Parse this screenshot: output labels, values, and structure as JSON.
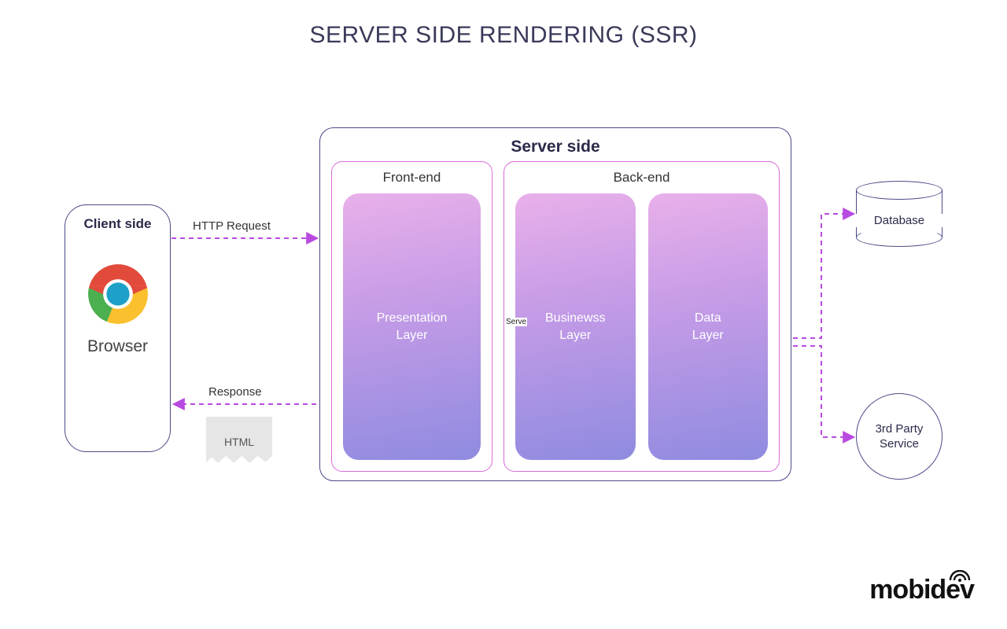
{
  "title": "SERVER SIDE RENDERING (SSR)",
  "client": {
    "box_label": "Client side",
    "browser_label": "Browser"
  },
  "server": {
    "box_label": "Server side",
    "frontend": {
      "label": "Front-end",
      "layer": "Presentation\nLayer"
    },
    "backend": {
      "label": "Back-end",
      "business_layer": "Businewss\nLayer",
      "data_layer": "Data\nLayer"
    }
  },
  "external": {
    "database": "Database",
    "third_party": "3rd Party\nService"
  },
  "arrows": {
    "request": "HTTP Request",
    "response": "Response",
    "response_payload": "HTML",
    "serve_text": "Serve"
  },
  "branding": {
    "logo_text": "mobidev"
  },
  "colors": {
    "border_dark": "#4a4a8a",
    "border_magenta": "#d96cd9",
    "arrow": "#b94ae0"
  }
}
